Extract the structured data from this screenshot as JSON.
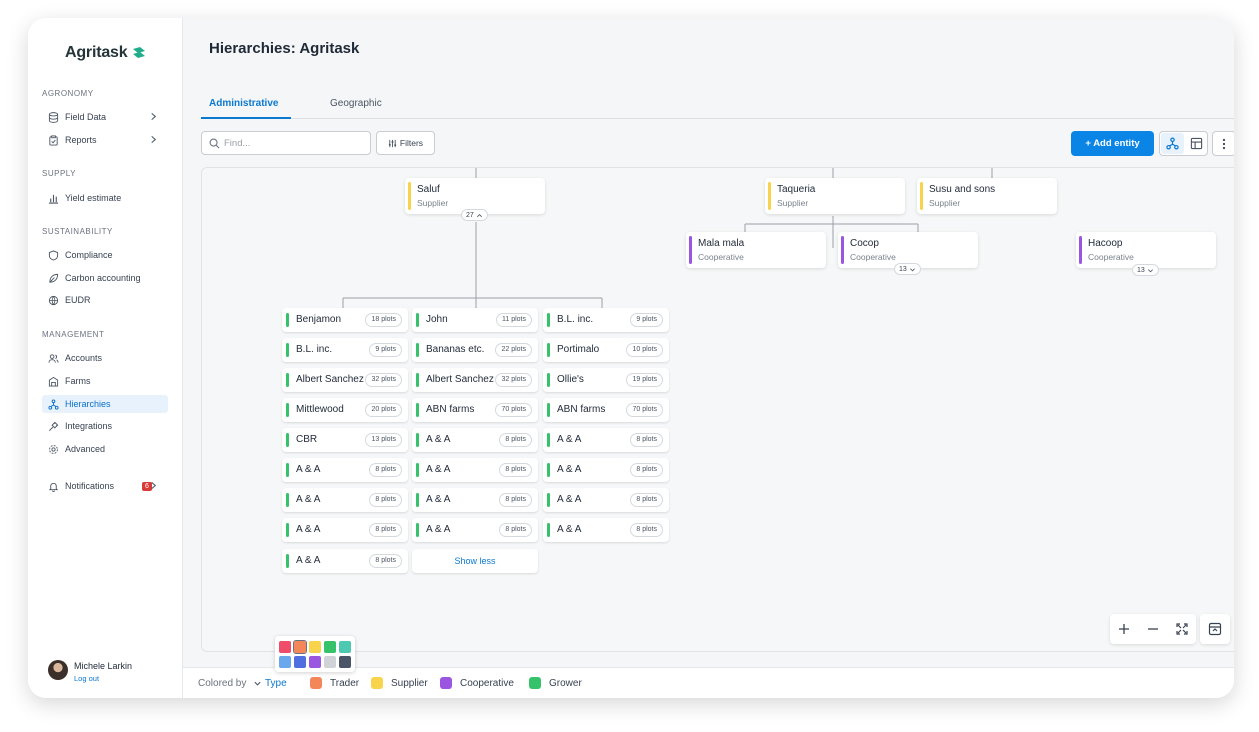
{
  "app": {
    "logo": "Agritask",
    "page_title": "Hierarchies: Agritask"
  },
  "sidebar": {
    "sections": [
      {
        "title": "AGRONOMY",
        "items": [
          {
            "label": "Field Data",
            "icon": "database-icon"
          },
          {
            "label": "Reports",
            "icon": "clipboard-icon"
          }
        ]
      },
      {
        "title": "SUPPLY",
        "items": [
          {
            "label": "Yield estimate",
            "icon": "bar-chart-icon"
          }
        ]
      },
      {
        "title": "SUSTAINABILITY",
        "items": [
          {
            "label": "Compliance",
            "icon": "shield-icon"
          },
          {
            "label": "Carbon accounting",
            "icon": "leaf-icon"
          },
          {
            "label": "EUDR",
            "icon": "globe-icon"
          }
        ]
      },
      {
        "title": "MANAGEMENT",
        "items": [
          {
            "label": "Accounts",
            "icon": "users-icon"
          },
          {
            "label": "Farms",
            "icon": "barn-icon"
          },
          {
            "label": "Hierarchies",
            "icon": "hierarchy-icon"
          },
          {
            "label": "Integrations",
            "icon": "plug-icon"
          },
          {
            "label": "Advanced",
            "icon": "gear-icon"
          }
        ]
      }
    ],
    "notifications": {
      "label": "Notifications",
      "count": "6"
    },
    "user": {
      "name": "Michele Larkin",
      "logout": "Log out"
    }
  },
  "tabs": {
    "administrative": "Administrative",
    "geographic": "Geographic"
  },
  "toolbar": {
    "search_placeholder": "Find...",
    "filters": "Filters",
    "add_entity": "+ Add entity"
  },
  "tree": {
    "saluf": {
      "name": "Saluf",
      "type": "Supplier",
      "count": "27"
    },
    "taqueria": {
      "name": "Taqueria",
      "type": "Supplier"
    },
    "susu": {
      "name": "Susu and sons",
      "type": "Supplier"
    },
    "mala": {
      "name": "Mala mala",
      "type": "Cooperative"
    },
    "cocop": {
      "name": "Cocop",
      "type": "Cooperative",
      "count": "13"
    },
    "hacoop": {
      "name": "Hacoop",
      "type": "Cooperative",
      "count": "13"
    },
    "growers": [
      [
        {
          "name": "Benjamon",
          "plots": "18 plots"
        },
        {
          "name": "B.L. inc.",
          "plots": "9 plots"
        },
        {
          "name": "Albert Sanchez",
          "plots": "32 plots"
        },
        {
          "name": "Mittlewood",
          "plots": "20 plots"
        },
        {
          "name": "CBR",
          "plots": "13 plots"
        },
        {
          "name": "A & A",
          "plots": "8 plots"
        },
        {
          "name": "A & A",
          "plots": "8 plots"
        },
        {
          "name": "A & A",
          "plots": "8 plots"
        },
        {
          "name": "A & A",
          "plots": "8 plots"
        }
      ],
      [
        {
          "name": "John",
          "plots": "11 plots"
        },
        {
          "name": "Bananas etc.",
          "plots": "22 plots"
        },
        {
          "name": "Albert Sanchez",
          "plots": "32 plots"
        },
        {
          "name": "ABN farms",
          "plots": "70 plots"
        },
        {
          "name": "A & A",
          "plots": "8 plots"
        },
        {
          "name": "A & A",
          "plots": "8 plots"
        },
        {
          "name": "A & A",
          "plots": "8 plots"
        },
        {
          "name": "A & A",
          "plots": "8 plots"
        }
      ],
      [
        {
          "name": "B.L. inc.",
          "plots": "9 plots"
        },
        {
          "name": "Portimalo",
          "plots": "10 plots"
        },
        {
          "name": "Ollie's",
          "plots": "19 plots"
        },
        {
          "name": "ABN farms",
          "plots": "70 plots"
        },
        {
          "name": "A & A",
          "plots": "8 plots"
        },
        {
          "name": "A & A",
          "plots": "8 plots"
        },
        {
          "name": "A & A",
          "plots": "8 plots"
        },
        {
          "name": "A & A",
          "plots": "8 plots"
        }
      ]
    ],
    "show_less": "Show less"
  },
  "legend": {
    "colored_by": "Colored by",
    "type": "Type",
    "items": [
      {
        "label": "Trader",
        "color": "#f4875a"
      },
      {
        "label": "Supplier",
        "color": "#f8d44c"
      },
      {
        "label": "Cooperative",
        "color": "#9a56e0"
      },
      {
        "label": "Grower",
        "color": "#36c26b"
      }
    ]
  },
  "colors": {
    "accent": "#0a85e6",
    "supplier": "#f8d44c",
    "cooperative": "#9a56e0",
    "grower": "#36c26b",
    "palette": [
      "#ef4d6a",
      "#f4875a",
      "#f8d44c",
      "#36c26b",
      "#4cc9b0",
      "#6aa8ee",
      "#4f6fe0",
      "#9a56e0",
      "#cfd3d8",
      "#4a5568"
    ]
  }
}
